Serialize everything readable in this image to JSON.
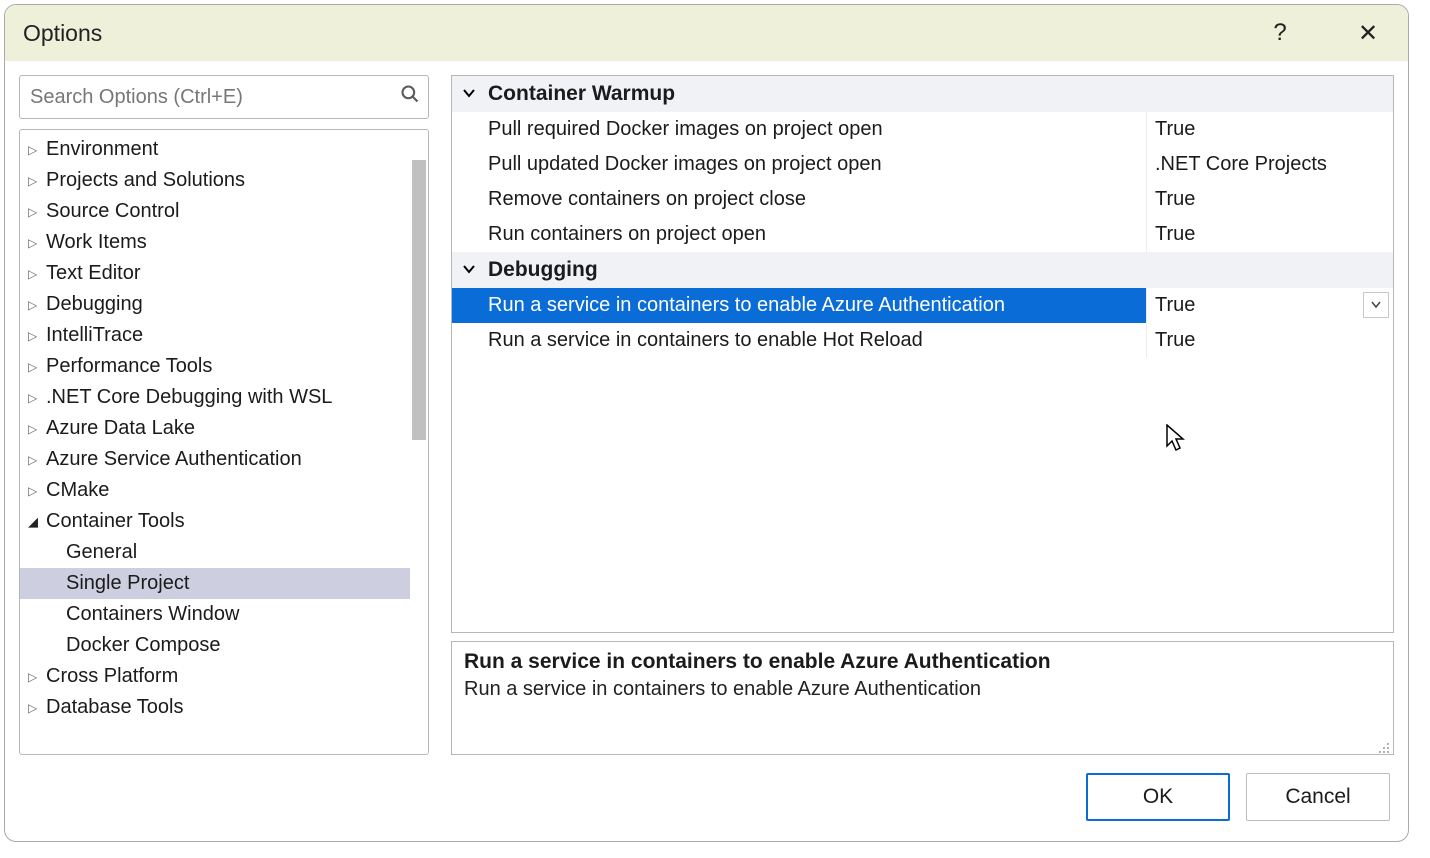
{
  "window": {
    "title": "Options",
    "help_tooltip": "?",
    "close_tooltip": "✕"
  },
  "search": {
    "placeholder": "Search Options (Ctrl+E)"
  },
  "tree": [
    {
      "label": "Environment",
      "kind": "collapsed"
    },
    {
      "label": "Projects and Solutions",
      "kind": "collapsed"
    },
    {
      "label": "Source Control",
      "kind": "collapsed"
    },
    {
      "label": "Work Items",
      "kind": "collapsed"
    },
    {
      "label": "Text Editor",
      "kind": "collapsed"
    },
    {
      "label": "Debugging",
      "kind": "collapsed"
    },
    {
      "label": "IntelliTrace",
      "kind": "collapsed"
    },
    {
      "label": "Performance Tools",
      "kind": "collapsed"
    },
    {
      "label": ".NET Core Debugging with WSL",
      "kind": "collapsed"
    },
    {
      "label": "Azure Data Lake",
      "kind": "collapsed"
    },
    {
      "label": "Azure Service Authentication",
      "kind": "collapsed"
    },
    {
      "label": "CMake",
      "kind": "collapsed"
    },
    {
      "label": "Container Tools",
      "kind": "expanded"
    },
    {
      "label": "General",
      "kind": "child"
    },
    {
      "label": "Single Project",
      "kind": "child",
      "selected": true
    },
    {
      "label": "Containers Window",
      "kind": "child"
    },
    {
      "label": "Docker Compose",
      "kind": "child"
    },
    {
      "label": "Cross Platform",
      "kind": "collapsed"
    },
    {
      "label": "Database Tools",
      "kind": "collapsed"
    }
  ],
  "propertygrid": {
    "categories": [
      {
        "name": "Container Warmup",
        "rows": [
          {
            "label": "Pull required Docker images on project open",
            "value": "True"
          },
          {
            "label": "Pull updated Docker images on project open",
            "value": ".NET Core Projects"
          },
          {
            "label": "Remove containers on project close",
            "value": "True"
          },
          {
            "label": "Run containers on project open",
            "value": "True"
          }
        ]
      },
      {
        "name": "Debugging",
        "rows": [
          {
            "label": "Run a service in containers to enable Azure Authentication",
            "value": "True",
            "selected": true,
            "dropdown": true
          },
          {
            "label": "Run a service in containers to enable Hot Reload",
            "value": "True"
          }
        ]
      }
    ]
  },
  "description": {
    "title": "Run a service in containers to enable Azure Authentication",
    "text": "Run a service in containers to enable Azure Authentication"
  },
  "buttons": {
    "ok": "OK",
    "cancel": "Cancel"
  }
}
